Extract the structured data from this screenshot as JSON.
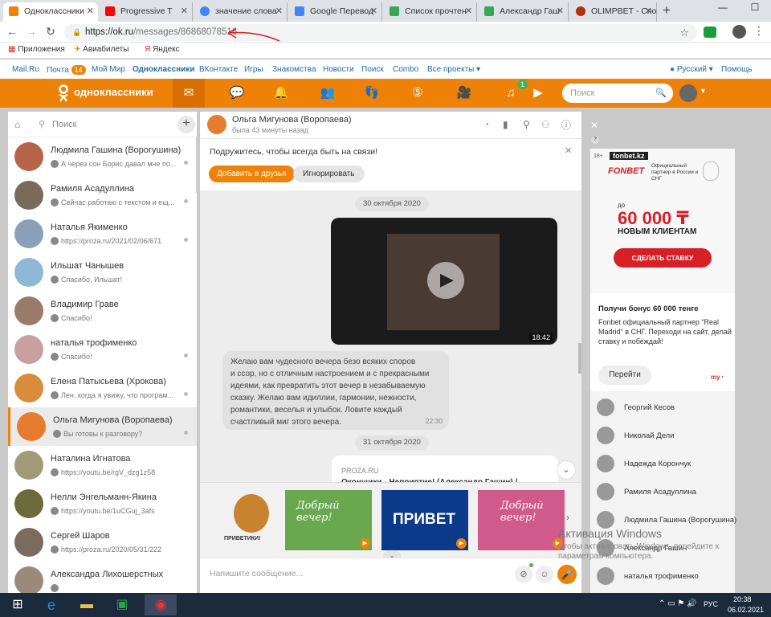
{
  "browser": {
    "tabs": [
      {
        "label": "Одноклассники",
        "favicon_color": "#ee8208"
      },
      {
        "label": "Progressive T",
        "favicon_color": "#ff0000"
      },
      {
        "label": "значение слова",
        "favicon_color": "#4285f4"
      },
      {
        "label": "Google Перевод",
        "favicon_color": "#4285f4"
      },
      {
        "label": "Список прочтен",
        "favicon_color": "#34a853"
      },
      {
        "label": "Александр Гаш",
        "favicon_color": "#34a853"
      },
      {
        "label": "OLIMPBET - Спо",
        "favicon_color": "#b33000"
      }
    ],
    "url_host": "https://ok.ru",
    "url_path": "/messages/86868078516",
    "bookmarks": [
      "Приложения",
      "Авиабилеты",
      "Яндекс"
    ]
  },
  "ok_links": {
    "items": [
      "Mail.Ru",
      "Почта",
      "Мой Мир",
      "Одноклассники",
      "ВКонтакте",
      "Игры",
      "Знакомства",
      "Новости",
      "Поиск",
      "Combo",
      "Все проекты ▾"
    ],
    "mail_count": "14",
    "lang": "Русский ▾",
    "help": "Помощь"
  },
  "okbar": {
    "logo": "одноклассники",
    "music_badge": "1",
    "search_placeholder": "Поиск"
  },
  "chatlist": {
    "search_placeholder": "Поиск",
    "items": [
      {
        "name": "Людмила Гашина (Ворогушина)",
        "msg": "А через сон Борис давал мне по...",
        "color": "#b7634a"
      },
      {
        "name": "Рамиля Асадуллина",
        "msg": "Сейчас работаю с текстом и ещ...",
        "color": "#7a6a5a"
      },
      {
        "name": "Наталья Якименко",
        "msg": "https://proza.ru/2021/02/06/671",
        "color": "#8aa0b8"
      },
      {
        "name": "Ильшат Чанышев",
        "msg": "Спасибо, Ильшат!",
        "color": "#8fb8d6"
      },
      {
        "name": "Владимир Граве",
        "msg": "Спасибо!",
        "color": "#9a7b6b"
      },
      {
        "name": "наталья трофименко",
        "msg": "Спасибо!",
        "color": "#c9a0a0"
      },
      {
        "name": "Елена Патысьева (Хрокова)",
        "msg": "Лен, когда я увижу, что програм...",
        "color": "#d98c3a"
      },
      {
        "name": "Ольга Мигунова (Воропаева)",
        "msg": "Вы готовы к разговору?",
        "color": "#e57c2e"
      },
      {
        "name": "Наталина Игнатова",
        "msg": "https://youtu.be/rgV_dzg1z58",
        "color": "#a09a78"
      },
      {
        "name": "Нелли Энгельманн-Якина",
        "msg": "https://youtu.be/1uCGuj_3afs",
        "color": "#6b6a3a"
      },
      {
        "name": "Сергей Шаров",
        "msg": "https://proza.ru/2020/05/31/222",
        "color": "#7a6b5e"
      },
      {
        "name": "Александра Лихошерстных",
        "msg": "",
        "color": "#9b8a7a"
      }
    ]
  },
  "chat": {
    "name": "Ольга Мигунова (Воропаева)",
    "status": "была 43 минуты назад",
    "suggest_text": "Подружитесь, чтобы всегда быть на связи!",
    "add_friend": "Добавить в друзья",
    "ignore": "Игнорировать",
    "date1": "30 октября 2020",
    "video_duration": "18:42",
    "message_lines": [
      "Желаю вам чудесного вечера безо всяких споров",
      "и ссор, но с отличным настроением и с прекрасными",
      "идеями, как превратить этот вечер в незабываемую",
      "сказку. Желаю вам идиллии, гармонии, нежности,",
      "романтики, веселья и улыбок. Ловите каждый",
      "счастливый миг этого вечера."
    ],
    "message_time": "22:30",
    "date2": "31 октября 2020",
    "link_site": "PROZA.RU",
    "link_title": "Оконщики - Неприятие! (Александр Гашин) /",
    "stickers": [
      "ПРИВЕТИКИ!",
      "Добрый вечер!",
      "ПРИВЕТ",
      "Добрый вечер!"
    ],
    "compose_placeholder": "Напишите сообщение..."
  },
  "ad": {
    "age": "18+",
    "site": "fonbet.kz",
    "brand": "FONBET",
    "partner": "Официальный партнер в России и СНГ",
    "amount_prefix": "до",
    "amount": "60 000 ₸",
    "amount_sub": "НОВЫМ КЛИЕНТАМ",
    "cta": "СДЕЛАТЬ СТАВКУ",
    "title": "Получи бонус 60 000 тенге",
    "desc": "Fonbet официальный партнер \"Real Madrid\" в СНГ. Переходи на сайт, делай ставку и побеждай!",
    "go": "Перейти"
  },
  "friends": [
    "Георгий Кесов",
    "Николай Дели",
    "Надежда Корончук",
    "Рамиля Асадуллина",
    "Людмила Гашина (Ворогушина)",
    "Александр Гашин",
    "наталья трофименко"
  ],
  "watermark": {
    "title": "Активация Windows",
    "line1": "Чтобы активировать Windows, перейдите к",
    "line2": "параметрам компьютера."
  },
  "taskbar": {
    "lang": "РУС",
    "time": "20:38",
    "date": "06.02.2021"
  }
}
